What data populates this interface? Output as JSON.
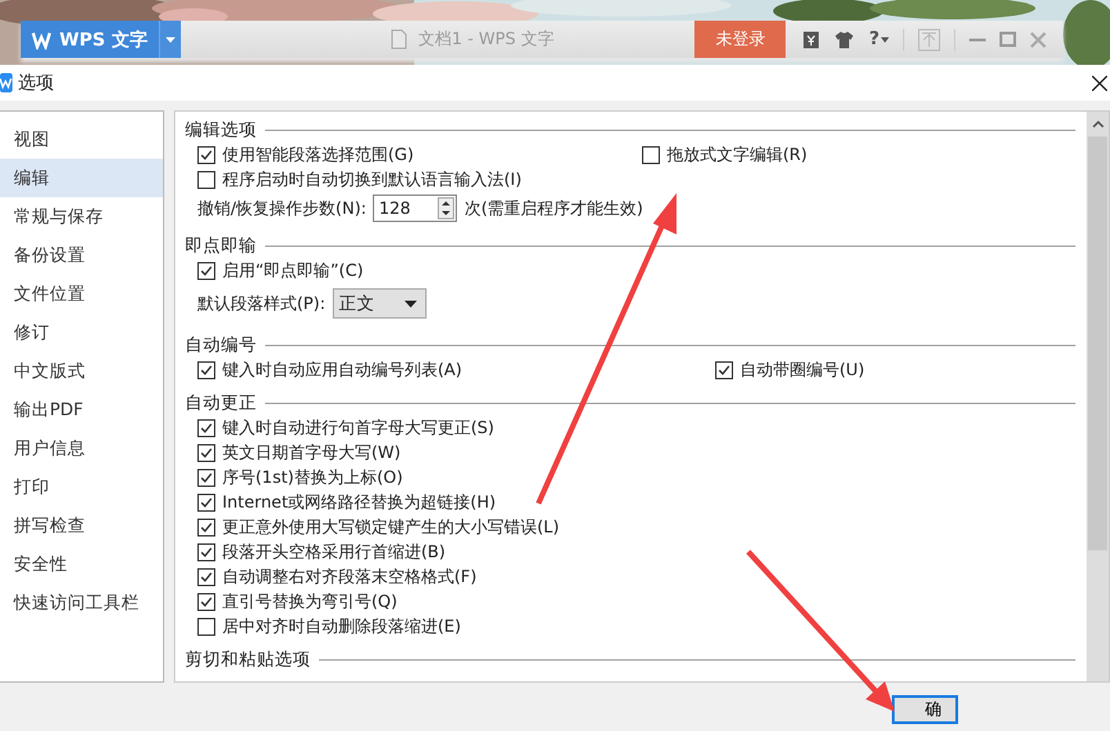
{
  "app_bar": {
    "logo": "WPS 文字",
    "document_title": "文档1 - WPS 文字",
    "login_button": "未登录",
    "help": "?"
  },
  "dialog": {
    "title": "选项"
  },
  "sidebar": {
    "items": [
      {
        "label": "视图",
        "selected": false
      },
      {
        "label": "编辑",
        "selected": true
      },
      {
        "label": "常规与保存",
        "selected": false
      },
      {
        "label": "备份设置",
        "selected": false
      },
      {
        "label": "文件位置",
        "selected": false
      },
      {
        "label": "修订",
        "selected": false
      },
      {
        "label": "中文版式",
        "selected": false
      },
      {
        "label": "输出PDF",
        "selected": false
      },
      {
        "label": "用户信息",
        "selected": false
      },
      {
        "label": "打印",
        "selected": false
      },
      {
        "label": "拼写检查",
        "selected": false
      },
      {
        "label": "安全性",
        "selected": false
      },
      {
        "label": "快速访问工具栏",
        "selected": false
      }
    ]
  },
  "sections": [
    {
      "title": "编辑选项",
      "rows": [
        {
          "items": [
            {
              "kind": "checkbox",
              "label": "使用智能段落选择范围(G)",
              "checked": true
            },
            {
              "kind": "checkbox",
              "label": "拖放式文字编辑(R)",
              "checked": false
            }
          ]
        },
        {
          "items": [
            {
              "kind": "checkbox",
              "label": "程序启动时自动切换到默认语言输入法(I)",
              "checked": false
            }
          ]
        },
        {
          "items": [
            {
              "kind": "spinner",
              "label": "撤销/恢复操作步数(N):",
              "value": "128",
              "suffix": "次(需重启程序才能生效)"
            }
          ]
        }
      ]
    },
    {
      "title": "即点即输",
      "rows": [
        {
          "items": [
            {
              "kind": "checkbox",
              "label": "启用“即点即输”(C)",
              "checked": true
            }
          ]
        },
        {
          "items": [
            {
              "kind": "select",
              "label": "默认段落样式(P):",
              "value": "正文"
            }
          ]
        }
      ]
    },
    {
      "title": "自动编号",
      "rows": [
        {
          "items": [
            {
              "kind": "checkbox",
              "label": "键入时自动应用自动编号列表(A)",
              "checked": true
            },
            {
              "kind": "checkbox",
              "label": "自动带圈编号(U)",
              "checked": true
            }
          ]
        }
      ]
    },
    {
      "title": "自动更正",
      "rows": [
        {
          "items": [
            {
              "kind": "checkbox",
              "label": "键入时自动进行句首字母大写更正(S)",
              "checked": true
            }
          ]
        },
        {
          "items": [
            {
              "kind": "checkbox",
              "label": "英文日期首字母大写(W)",
              "checked": true
            }
          ]
        },
        {
          "items": [
            {
              "kind": "checkbox",
              "label": "序号(1st)替换为上标(O)",
              "checked": true
            }
          ]
        },
        {
          "items": [
            {
              "kind": "checkbox",
              "label": "Internet或网络路径替换为超链接(H)",
              "checked": true
            }
          ]
        },
        {
          "items": [
            {
              "kind": "checkbox",
              "label": "更正意外使用大写锁定键产生的大小写错误(L)",
              "checked": true
            }
          ]
        },
        {
          "items": [
            {
              "kind": "checkbox",
              "label": "段落开头空格采用行首缩进(B)",
              "checked": true
            }
          ]
        },
        {
          "items": [
            {
              "kind": "checkbox",
              "label": "自动调整右对齐段落末空格格式(F)",
              "checked": true
            }
          ]
        },
        {
          "items": [
            {
              "kind": "checkbox",
              "label": "直引号替换为弯引号(Q)",
              "checked": true
            }
          ]
        },
        {
          "items": [
            {
              "kind": "checkbox",
              "label": "居中对齐时自动删除段落缩进(E)",
              "checked": false
            }
          ]
        }
      ]
    },
    {
      "title": "剪切和粘贴选项"
    }
  ],
  "buttons": [
    {
      "label": "确"
    }
  ]
}
